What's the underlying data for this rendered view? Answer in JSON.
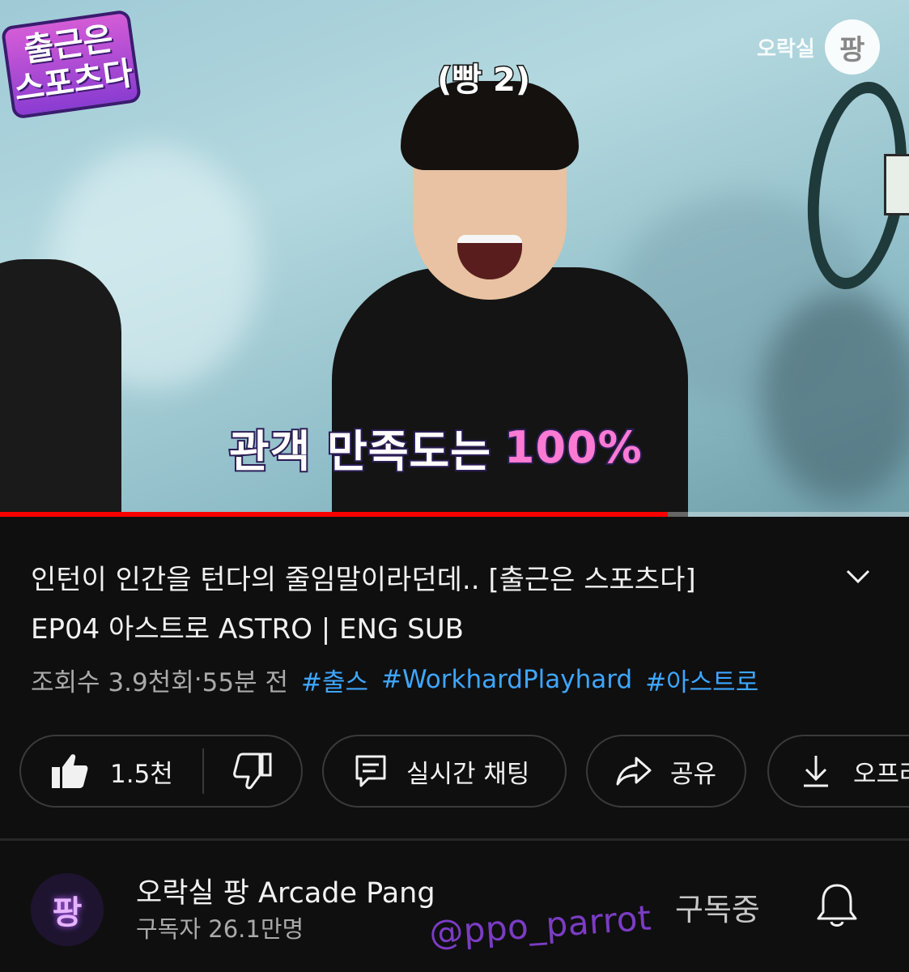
{
  "player": {
    "badge_line1": "출근은",
    "badge_line2": "스포츠다",
    "watermark_text": "오락실",
    "watermark_logo": "팡",
    "caption_top": "(빵 2)",
    "caption_bottom_main": "관객 만족도는",
    "caption_bottom_accent": "100%",
    "progress_fraction": 0.735,
    "progress_color": "#ff0000"
  },
  "video": {
    "title_line1": "인턴이 인간을 턴다의 줄임말이라던데.. [출근은 스포츠다]",
    "title_line2": "EP04 아스트로 ASTRO | ENG SUB",
    "views": "조회수 3.9천회",
    "separator": " · ",
    "age": "55분 전",
    "hashtags": [
      "#출스",
      "#WorkhardPlayhard",
      "#아스트로"
    ],
    "expand_icon": "chevron-down-icon"
  },
  "actions": {
    "like_count": "1.5천",
    "live_chat_label": "실시간 채팅",
    "share_label": "공유",
    "offline_label": "오프라"
  },
  "channel": {
    "avatar_text": "팡",
    "name": "오락실 팡 Arcade Pang",
    "subscribers": "구독자 26.1만명",
    "subscribed_label": "구독중",
    "bell_icon": "bell-icon"
  },
  "overlay": {
    "handle": "@ppo_parrot",
    "handle_color": "#7b3cc4"
  },
  "colors": {
    "background": "#0f0f0f",
    "link": "#3ea6ff",
    "muted": "#aaaaaa"
  }
}
